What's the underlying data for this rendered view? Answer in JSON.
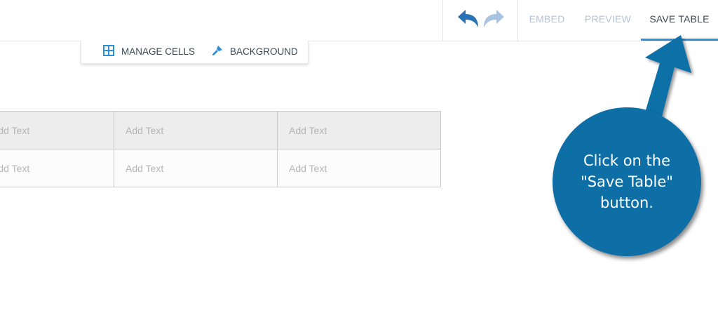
{
  "header": {
    "undo_icon": "undo-icon",
    "redo_icon": "redo-icon",
    "embed_label": "EMBED",
    "preview_label": "PREVIEW",
    "save_label": "SAVE TABLE",
    "accent_color": "#2f8fd6"
  },
  "toolbar": {
    "manage_cells_label": "MANAGE CELLS",
    "manage_cells_icon": "grid-icon",
    "background_label": "BACKGROUND",
    "background_icon": "paint-brush-icon"
  },
  "table": {
    "rows": [
      [
        "Add Text",
        "Add Text",
        "Add Text"
      ],
      [
        "Add Text",
        "Add Text",
        "Add Text"
      ]
    ]
  },
  "callout": {
    "text": "Click on the\n\"Save Table\"\nbutton.",
    "color": "#0e6fa6"
  }
}
